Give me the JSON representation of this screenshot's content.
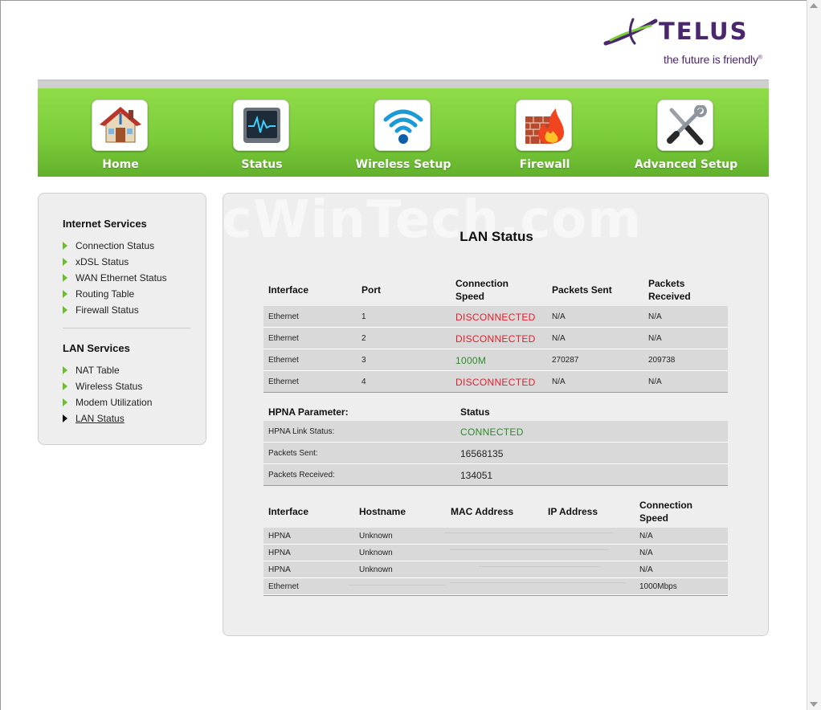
{
  "brand": {
    "name": "TELUS",
    "tagline": "the future is friendly",
    "tagline_mark": "®",
    "purple": "#4b286d",
    "green": "#7ccd3a"
  },
  "nav": {
    "items": [
      {
        "label": "Home",
        "icon": "house-icon"
      },
      {
        "label": "Status",
        "icon": "monitor-icon"
      },
      {
        "label": "Wireless Setup",
        "icon": "wifi-icon"
      },
      {
        "label": "Firewall",
        "icon": "firewall-icon"
      },
      {
        "label": "Advanced Setup",
        "icon": "tools-icon"
      }
    ]
  },
  "sidebar": {
    "internet_title": "Internet Services",
    "internet_items": [
      "Connection Status",
      "xDSL Status",
      "WAN Ethernet Status",
      "Routing Table",
      "Firewall Status"
    ],
    "lan_title": "LAN Services",
    "lan_items": [
      "NAT Table",
      "Wireless Status",
      "Modem Utilization",
      "LAN Status"
    ],
    "active": "LAN Status"
  },
  "main": {
    "watermark": "PcWinTech.com",
    "title": "LAN Status",
    "ports": {
      "headers": [
        "Interface",
        "Port",
        "Connection Speed",
        "Packets Sent",
        "Packets Received"
      ],
      "header_lines": {
        "speed_1": "Connection",
        "speed_2": "Speed",
        "recv_1": "Packets",
        "recv_2": "Received"
      },
      "rows": [
        {
          "interface": "Ethernet",
          "port": "1",
          "speed": "DISCONNECTED",
          "sent": "N/A",
          "received": "N/A"
        },
        {
          "interface": "Ethernet",
          "port": "2",
          "speed": "DISCONNECTED",
          "sent": "N/A",
          "received": "N/A"
        },
        {
          "interface": "Ethernet",
          "port": "3",
          "speed": "1000M",
          "sent": "270287",
          "received": "209738"
        },
        {
          "interface": "Ethernet",
          "port": "4",
          "speed": "DISCONNECTED",
          "sent": "N/A",
          "received": "N/A"
        }
      ]
    },
    "hpna": {
      "param_header": "HPNA Parameter:",
      "status_header": "Status",
      "rows": [
        {
          "label": "HPNA Link Status:",
          "value": "CONNECTED"
        },
        {
          "label": "Packets Sent:",
          "value": "16568135"
        },
        {
          "label": "Packets Received:",
          "value": "134051"
        }
      ]
    },
    "hosts": {
      "headers": {
        "interface": "Interface",
        "hostname": "Hostname",
        "mac": "MAC Address",
        "ip": "IP Address",
        "speed_1": "Connection",
        "speed_2": "Speed"
      },
      "rows": [
        {
          "interface": "HPNA",
          "hostname": "Unknown",
          "speed": "N/A"
        },
        {
          "interface": "HPNA",
          "hostname": "Unknown",
          "speed": "N/A"
        },
        {
          "interface": "HPNA",
          "hostname": "Unknown",
          "speed": "N/A"
        },
        {
          "interface": "Ethernet",
          "hostname": "",
          "speed": "1000Mbps"
        }
      ]
    }
  }
}
